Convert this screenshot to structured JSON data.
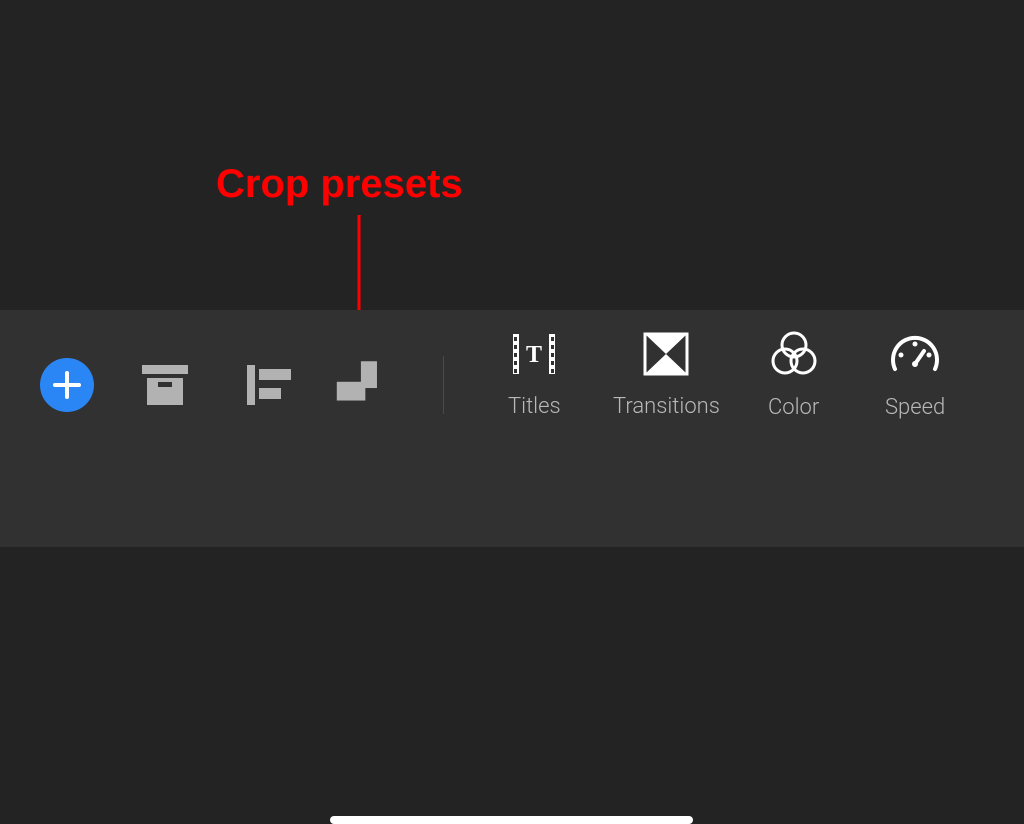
{
  "annotation": {
    "label": "Crop presets"
  },
  "toolbar": {
    "add_button": "add",
    "archive_button": "archive",
    "align_button": "align-left",
    "crop_button": "crop-presets",
    "tools": [
      {
        "icon": "titles",
        "label": "Titles"
      },
      {
        "icon": "transitions",
        "label": "Transitions"
      },
      {
        "icon": "color",
        "label": "Color"
      },
      {
        "icon": "speed",
        "label": "Speed"
      }
    ]
  }
}
